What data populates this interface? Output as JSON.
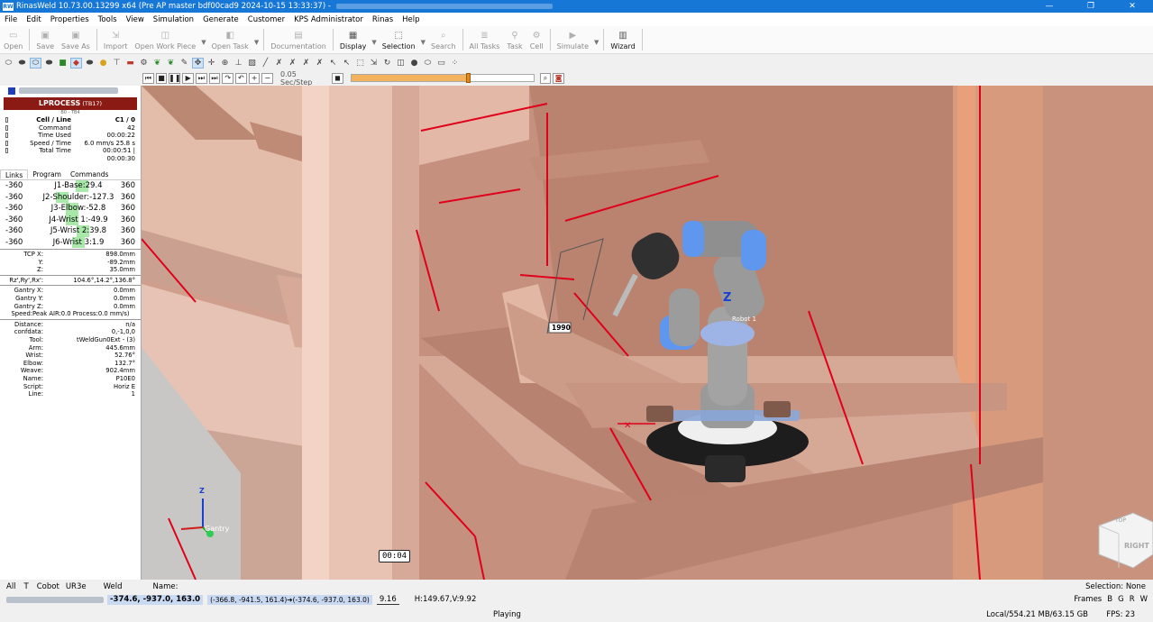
{
  "window": {
    "title": "RinasWeld 10.73.00.13299 x64 (Pre AP master bdf00cad9 2024-10-15 13:33:37) -",
    "app_icon_label": "RW",
    "controls": {
      "minimize": "—",
      "maximize": "❐",
      "close": "✕"
    }
  },
  "menu": [
    "File",
    "Edit",
    "Properties",
    "Tools",
    "View",
    "Simulation",
    "Generate",
    "Customer",
    "KPS Administrator",
    "Rinas",
    "Help"
  ],
  "toolbar": {
    "open": "Open",
    "save": "Save",
    "save_as": "Save As",
    "import": "Import",
    "open_work_piece": "Open Work Piece",
    "open_task": "Open Task",
    "documentation": "Documentation",
    "display": "Display",
    "selection": "Selection",
    "search": "Search",
    "all_tasks": "All Tasks",
    "task": "Task",
    "cell": "Cell",
    "simulate": "Simulate",
    "wizard": "Wizard"
  },
  "playback": {
    "speed_label": "0.05 Sec/Step",
    "progress_fraction": 0.62
  },
  "process": {
    "header": "LPROCESS",
    "header_tag": "(TB17)",
    "sub": "B0 - TB4",
    "cell_line_label": "Cell / Line",
    "cell_line_value": "C1 / 0",
    "command_label": "Command",
    "command_value": "42",
    "time_used_label": "Time Used",
    "time_used_value": "00:00:22",
    "speed_time_label": "Speed / Time",
    "speed_time_value": "6.0 mm/s  25.8 s",
    "total_time_label": "Total Time",
    "total_time_value": "00:00:51 | 00:00:30"
  },
  "tabs": [
    "Links",
    "Program",
    "Commands"
  ],
  "joints": [
    {
      "lo": "-360",
      "name": "J1-Base:29.4",
      "hi": "360",
      "level": 0.54
    },
    {
      "lo": "-360",
      "name": "J2-Shoulder:-127.3",
      "hi": "360",
      "level": 0.32
    },
    {
      "lo": "-360",
      "name": "J3-Elbow:-52.8",
      "hi": "360",
      "level": 0.43
    },
    {
      "lo": "-360",
      "name": "J4-Wrist 1:-49.9",
      "hi": "360",
      "level": 0.43
    },
    {
      "lo": "-360",
      "name": "J5-Wrist 2:39.8",
      "hi": "360",
      "level": 0.55
    },
    {
      "lo": "-360",
      "name": "J6-Wrist 3:1.9",
      "hi": "360",
      "level": 0.5
    }
  ],
  "tcp": [
    {
      "k": "TCP X:",
      "v": "898.0mm"
    },
    {
      "k": "Y:",
      "v": "-89.2mm"
    },
    {
      "k": "Z:",
      "v": "35.0mm"
    }
  ],
  "orient": {
    "k": "Rz',Ry',Rx':",
    "v": "104.6°,14.2°,136.8°"
  },
  "gantry": [
    {
      "k": "Gantry X:",
      "v": "0.0mm"
    },
    {
      "k": "Gantry Y:",
      "v": "0.0mm"
    },
    {
      "k": "Gantry Z:",
      "v": "0.0mm"
    }
  ],
  "speed_line": "Speed:Peak AIR:0.0 Process:0.0 mm/s)",
  "misc": [
    {
      "k": "Distance:",
      "v": "n/a"
    },
    {
      "k": "confdata:",
      "v": "0,-1,0,0"
    },
    {
      "k": "Tool:",
      "v": "tWeldGun0Ext - (3)"
    },
    {
      "k": "Arm:",
      "v": "445.6mm"
    },
    {
      "k": "Wrist:",
      "v": "52.76°"
    },
    {
      "k": "Elbow:",
      "v": "132.7°"
    },
    {
      "k": "Weave:",
      "v": "902.4mm"
    },
    {
      "k": "Name:",
      "v": "P10E0"
    },
    {
      "k": "Script:",
      "v": "Horiz E"
    },
    {
      "k": "Line:",
      "v": "1"
    }
  ],
  "viewport": {
    "timer": "00:04",
    "label_1990": "1990",
    "robot_label": "Robot 1",
    "gantry_label": "Gantry",
    "axis_z": "Z",
    "cube_top": "TOP",
    "cube_right": "RIGHT"
  },
  "bottom": {
    "filters": [
      "All",
      "T",
      "Cobot",
      "UR3e",
      "Weld"
    ],
    "name_label": "Name:",
    "selection": "Selection: None",
    "coords": "-374.6, -937.0, 163.0",
    "segment": "(-366.8, -941.5, 161.4)➔(-374.6, -937.0, 163.0)",
    "length": "9.16",
    "hv": "H:149.67,V:9.92",
    "frames_label": "Frames",
    "frames": [
      "B",
      "G",
      "R",
      "W"
    ],
    "status": "Playing",
    "memory": "Local/554.21 MB/63.15 GB",
    "fps": "FPS: 23"
  },
  "colors": {
    "title_blue": "#1777d6",
    "process_red": "#8b1a14",
    "steel": "#cf9e8c",
    "weld_line": "#e0001a",
    "robot_blue": "#5f97ef"
  }
}
